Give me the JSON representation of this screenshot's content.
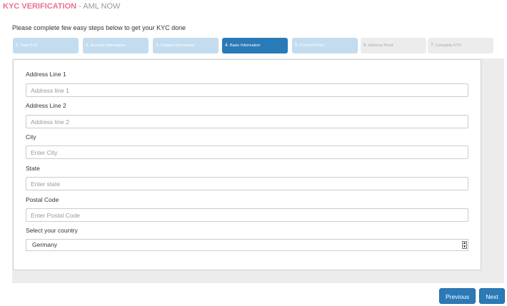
{
  "header": {
    "brand": "KYC VERIFICATION",
    "subtitle": " - AML NOW"
  },
  "intro": "Please complete few easy steps below to get your KYC done",
  "steps": [
    {
      "num": "1.",
      "label": "Start KYC",
      "state": "done"
    },
    {
      "num": "2.",
      "label": "Account Information",
      "state": "done"
    },
    {
      "num": "3.",
      "label": "Contact Information",
      "state": "done"
    },
    {
      "num": "4.",
      "label": "Basic Information",
      "state": "active"
    },
    {
      "num": "5.",
      "label": "Proof of Proof",
      "state": "done"
    },
    {
      "num": "6.",
      "label": "Address Proof",
      "state": "todo"
    },
    {
      "num": "7.",
      "label": "Complete KYC",
      "state": "todo"
    }
  ],
  "form": {
    "address1": {
      "label": "Address Line 1",
      "placeholder": "Address line 1"
    },
    "address2": {
      "label": "Address Line 2",
      "placeholder": "Address line 2"
    },
    "city": {
      "label": "City",
      "placeholder": "Enter City"
    },
    "state": {
      "label": "State",
      "placeholder": "Enter state"
    },
    "postal": {
      "label": "Postal Code",
      "placeholder": "Enter Postal Code"
    },
    "country": {
      "label": "Select your country",
      "value": "Germany"
    }
  },
  "buttons": {
    "previous": "Previous",
    "next": "Next"
  },
  "colors": {
    "brand": "#e8738e",
    "active_step": "#2a7ab8",
    "done_step": "#c3dcef",
    "todo_step": "#ececec",
    "button": "#2a7ab8"
  }
}
